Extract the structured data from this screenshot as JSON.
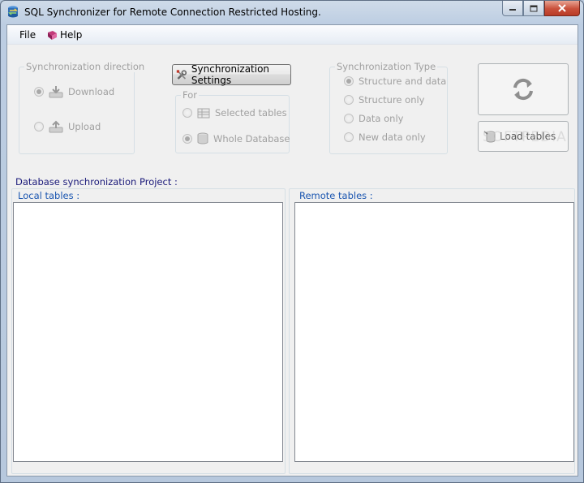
{
  "window": {
    "title": "SQL Synchronizer for Remote Connection Restricted Hosting."
  },
  "menu": {
    "file": "File",
    "help": "Help"
  },
  "direction": {
    "caption": "Synchronization direction",
    "options": [
      {
        "label": "Download",
        "checked": true
      },
      {
        "label": "Upload",
        "checked": false
      }
    ]
  },
  "settings": {
    "button_label": "Synchronization Settings",
    "for_caption": "For",
    "options": [
      {
        "label": "Selected tables",
        "checked": false
      },
      {
        "label": "Whole Database",
        "checked": true
      }
    ]
  },
  "sync_type": {
    "caption": "Synchronization Type",
    "options": [
      {
        "label": "Structure and data",
        "checked": true
      },
      {
        "label": "Structure only",
        "checked": false
      },
      {
        "label": "Data only",
        "checked": false
      },
      {
        "label": "New data only",
        "checked": false
      }
    ]
  },
  "actions": {
    "load_tables_label": "Load tables"
  },
  "project": {
    "label": "Database synchronization Project :",
    "local_tables_label": "Local tables :",
    "remote_tables_label": "Remote tables :"
  },
  "watermark": "SOFTPEDIA",
  "colors": {
    "accent_blue": "#1a55b0",
    "disabled_text": "#a0a0a0",
    "close_red": "#c9503b"
  }
}
